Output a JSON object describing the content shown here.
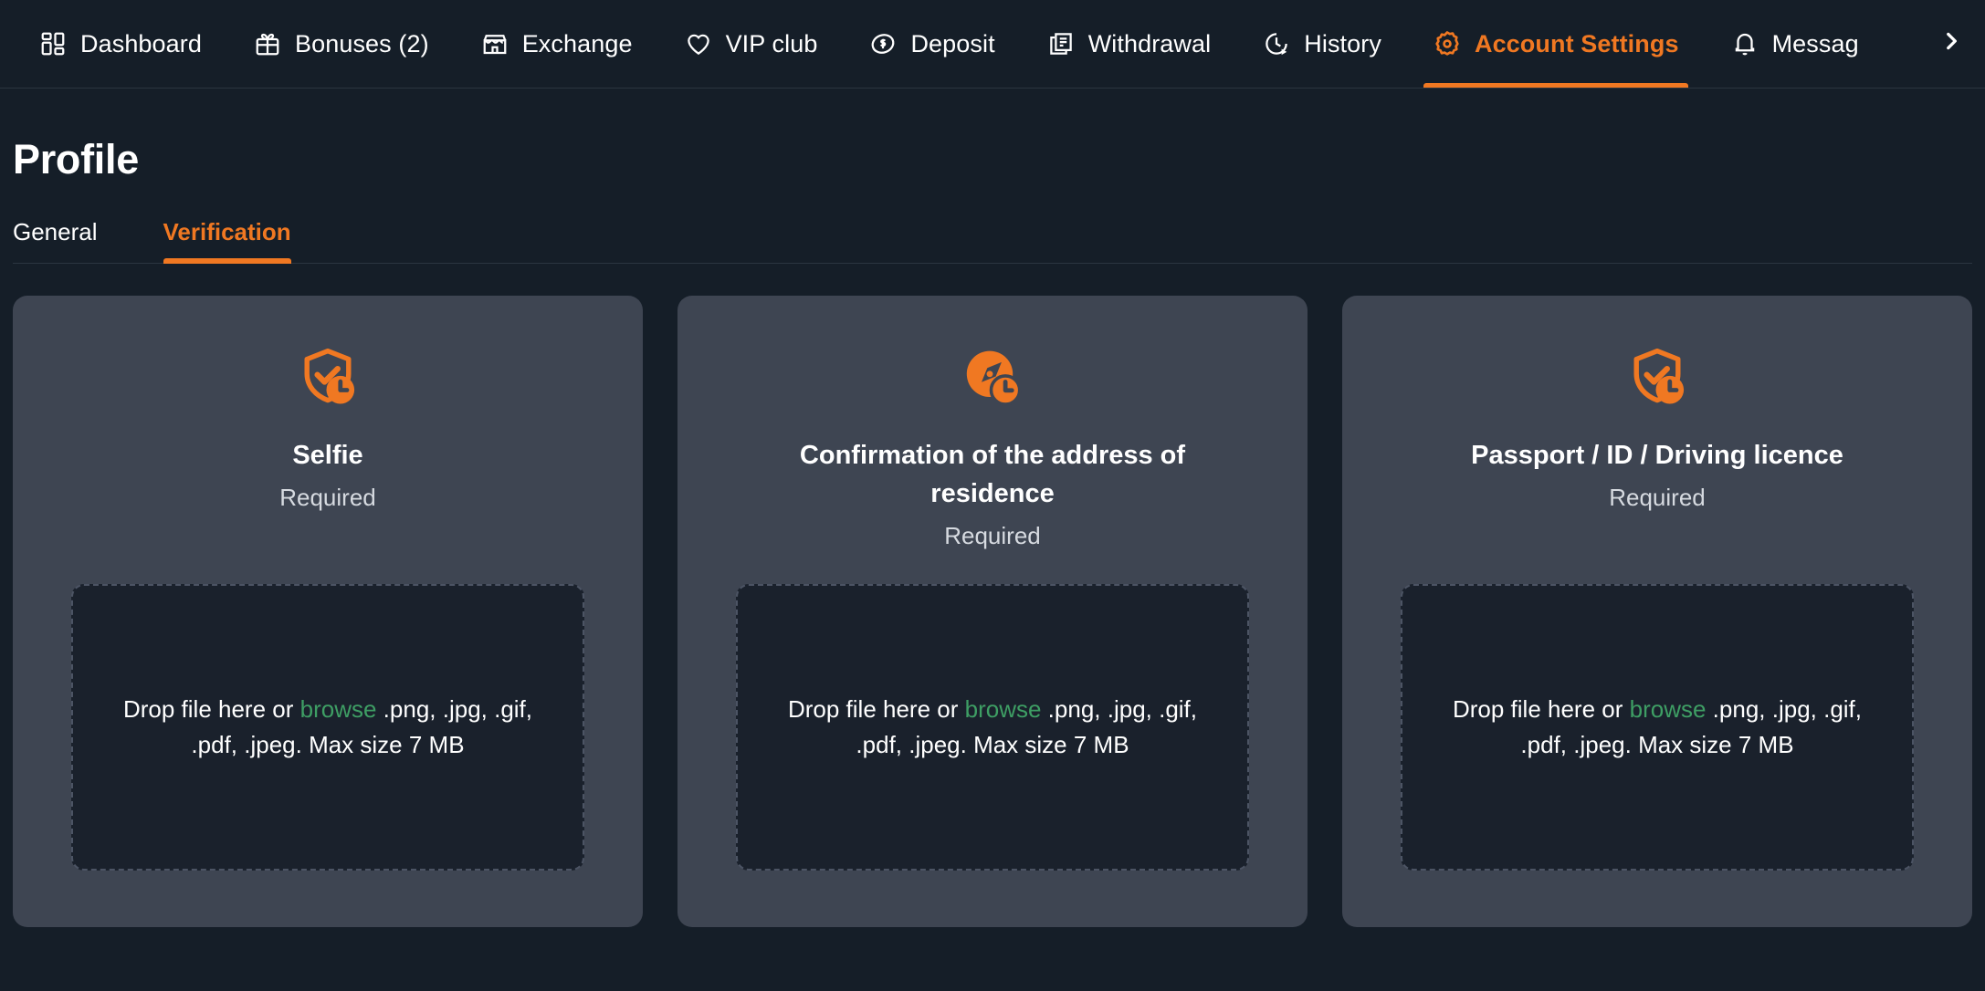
{
  "nav": {
    "items": [
      {
        "label": "Dashboard",
        "icon": "dashboard-icon",
        "active": false
      },
      {
        "label": "Bonuses  (2)",
        "icon": "gift-icon",
        "active": false
      },
      {
        "label": "Exchange",
        "icon": "store-icon",
        "active": false
      },
      {
        "label": "VIP club",
        "icon": "heart-icon",
        "active": false
      },
      {
        "label": "Deposit",
        "icon": "coin-dollar-icon",
        "active": false
      },
      {
        "label": "Withdrawal",
        "icon": "banknote-icon",
        "active": false
      },
      {
        "label": "History",
        "icon": "clock-history-icon",
        "active": false
      },
      {
        "label": "Account Settings",
        "icon": "gear-icon",
        "active": true
      },
      {
        "label": "Messag",
        "icon": "bell-icon",
        "active": false
      }
    ],
    "scroll_right_icon": "chevron-right-icon",
    "accent_color": "#f07822"
  },
  "page": {
    "title": "Profile",
    "tabs": [
      {
        "label": "General",
        "active": false
      },
      {
        "label": "Verification",
        "active": true
      }
    ]
  },
  "cards": [
    {
      "icon": "shield-check-clock-icon",
      "title": "Selfie",
      "status": "Required",
      "dropzone": {
        "prefix": "Drop file here or ",
        "browse": "browse",
        "suffix": " .png, .jpg, .gif, .pdf, .jpeg. Max size 7 MB",
        "browse_color": "#3e9e64"
      }
    },
    {
      "icon": "compass-clock-icon",
      "title": "Confirmation of the address of residence",
      "status": "Required",
      "dropzone": {
        "prefix": "Drop file here or ",
        "browse": "browse",
        "suffix": " .png, .jpg, .gif, .pdf, .jpeg. Max size 7 MB",
        "browse_color": "#3e9e64"
      }
    },
    {
      "icon": "shield-check-clock-icon",
      "title": "Passport / ID / Driving licence",
      "status": "Required",
      "dropzone": {
        "prefix": "Drop file here or ",
        "browse": "browse",
        "suffix": " .png, .jpg, .gif, .pdf, .jpeg. Max size 7 MB",
        "browse_color": "#3e9e64"
      }
    }
  ],
  "colors": {
    "page_bg": "#151e28",
    "card_bg": "#3e4552",
    "dropzone_bg": "#1a212c",
    "accent": "#f07822",
    "text": "#ffffff"
  }
}
